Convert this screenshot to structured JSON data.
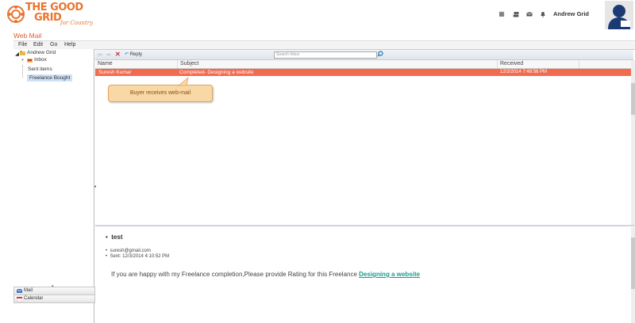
{
  "header": {
    "logo_line1": "THE GOOD",
    "logo_line2": "GRID",
    "logo_tagline": "for Country",
    "user_name": "Andrew Grid"
  },
  "app": {
    "title": "Web Mail"
  },
  "menu": {
    "items": [
      "File",
      "Edit",
      "Go",
      "Help"
    ]
  },
  "folders": {
    "account": "Andrew Grid",
    "items": [
      "Inbox",
      "Sent items",
      "Freelance Bought"
    ]
  },
  "bottom_tabs": [
    "Mail",
    "Calendar"
  ],
  "toolbar": {
    "reply_label": "Reply",
    "search_placeholder": "Search Inbox"
  },
  "grid": {
    "columns": [
      "Name",
      "Subject",
      "Received"
    ],
    "rows": [
      {
        "name": "Suresh Kumar",
        "subject": "Completed- Designing a website",
        "received": "12/2/2014 7:48:56 PM"
      }
    ]
  },
  "callout": "Buyer receives web-mail",
  "preview": {
    "title": "test",
    "from": "suresh@gmail.com",
    "sent": "Sent: 12/3/2014 4:10:52 PM",
    "body_text": "If you are happy with my Freelance completion,Please provide Rating for this  Freelance ",
    "link_text": "Designing a website"
  },
  "colors": {
    "accent": "#f26a4f",
    "brand": "#e8752f",
    "link": "#199c8b"
  }
}
